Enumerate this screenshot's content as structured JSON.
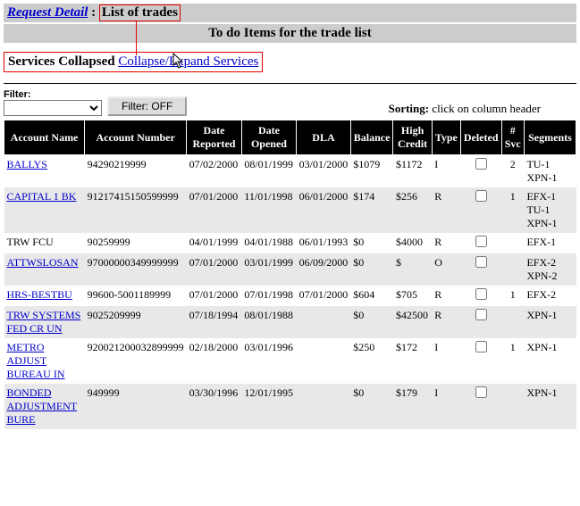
{
  "header": {
    "request_detail_link": "Request Detail",
    "separator": " : ",
    "title": "List of trades"
  },
  "subheader": "To do Items for the trade list",
  "services": {
    "status_label": "Services Collapsed",
    "toggle_link": "Collapse/Expand Services"
  },
  "filter": {
    "label": "Filter:",
    "selected": "",
    "button": "Filter: OFF"
  },
  "sorting_note_prefix": "Sorting:",
  "sorting_note_rest": " click on column header",
  "columns": [
    "Account Name",
    "Account Number",
    "Date Reported",
    "Date Opened",
    "DLA",
    "Balance",
    "High Credit",
    "Type",
    "Deleted",
    "# Svc",
    "Segments"
  ],
  "rows": [
    {
      "acct": "BALLYS",
      "num": "94290219999",
      "rep": "07/02/2000",
      "open": "08/01/1999",
      "dla": "03/01/2000",
      "bal": "$1079",
      "hc": "$1172",
      "type": "I",
      "del": false,
      "svc": "2",
      "seg": "TU-1 XPN-1"
    },
    {
      "acct": "CAPITAL 1 BK",
      "num": "91217415150599999",
      "rep": "07/01/2000",
      "open": "11/01/1998",
      "dla": "06/01/2000",
      "bal": "$174",
      "hc": "$256",
      "type": "R",
      "del": false,
      "svc": "1",
      "seg": "EFX-1 TU-1 XPN-1"
    },
    {
      "acct": "TRW FCU",
      "num": "90259999",
      "rep": "04/01/1999",
      "open": "04/01/1988",
      "dla": "06/01/1993",
      "bal": "$0",
      "hc": "$4000",
      "type": "R",
      "del": false,
      "svc": "",
      "seg": "EFX-1"
    },
    {
      "acct": "ATTWSLOSAN",
      "num": "97000000349999999",
      "rep": "07/01/2000",
      "open": "03/01/1999",
      "dla": "06/09/2000",
      "bal": "$0",
      "hc": "$",
      "type": "O",
      "del": false,
      "svc": "",
      "seg": "EFX-2 XPN-2"
    },
    {
      "acct": "HRS-BESTBU",
      "num": "99600-5001189999",
      "rep": "07/01/2000",
      "open": "07/01/1998",
      "dla": "07/01/2000",
      "bal": "$604",
      "hc": "$705",
      "type": "R",
      "del": false,
      "svc": "1",
      "seg": "EFX-2"
    },
    {
      "acct": "TRW SYSTEMS FED CR UN",
      "num": "9025209999",
      "rep": "07/18/1994",
      "open": "08/01/1988",
      "dla": "",
      "bal": "$0",
      "hc": "$42500",
      "type": "R",
      "del": false,
      "svc": "",
      "seg": "XPN-1"
    },
    {
      "acct": "METRO ADJUST BUREAU IN",
      "num": "920021200032899999",
      "rep": "02/18/2000",
      "open": "03/01/1996",
      "dla": "",
      "bal": "$250",
      "hc": "$172",
      "type": "I",
      "del": false,
      "svc": "1",
      "seg": "XPN-1"
    },
    {
      "acct": "BONDED ADJUSTMENT BURE",
      "num": "949999",
      "rep": "03/30/1996",
      "open": "12/01/1995",
      "dla": "",
      "bal": "$0",
      "hc": "$179",
      "type": "I",
      "del": false,
      "svc": "",
      "seg": "XPN-1"
    }
  ]
}
